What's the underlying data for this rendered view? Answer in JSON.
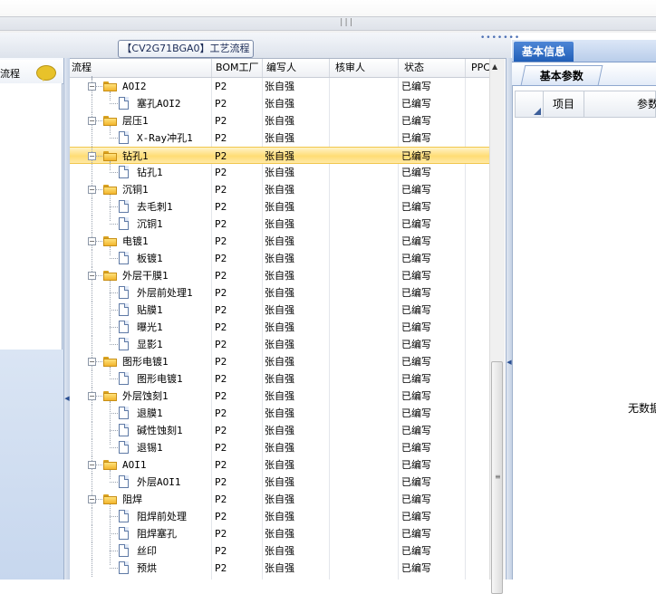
{
  "window": {
    "grip_glyph": "|||"
  },
  "left_panel": {
    "header_label": "流程"
  },
  "process_title": "【CV2G71BGA0】工艺流程",
  "grid": {
    "columns": [
      "流程",
      "BOM工厂",
      "编写人",
      "核审人",
      "状态",
      "PPC"
    ],
    "rows": [
      {
        "level": 0,
        "type": "folder",
        "name": "AOI2",
        "bom": "P2",
        "writer": "张自强",
        "reviewer": "",
        "status": "已编写",
        "ppc": ""
      },
      {
        "level": 1,
        "type": "doc",
        "name": "塞孔AOI2",
        "bom": "P2",
        "writer": "张自强",
        "reviewer": "",
        "status": "已编写",
        "ppc": ""
      },
      {
        "level": 0,
        "type": "folder",
        "name": "层压1",
        "bom": "P2",
        "writer": "张自强",
        "reviewer": "",
        "status": "已编写",
        "ppc": ""
      },
      {
        "level": 1,
        "type": "doc",
        "name": "X-Ray冲孔1",
        "bom": "P2",
        "writer": "张自强",
        "reviewer": "",
        "status": "已编写",
        "ppc": ""
      },
      {
        "level": 0,
        "type": "folder",
        "name": "钻孔1",
        "bom": "P2",
        "writer": "张自强",
        "reviewer": "",
        "status": "已编写",
        "ppc": "",
        "selected": true
      },
      {
        "level": 1,
        "type": "doc",
        "name": "钻孔1",
        "bom": "P2",
        "writer": "张自强",
        "reviewer": "",
        "status": "已编写",
        "ppc": ""
      },
      {
        "level": 0,
        "type": "folder",
        "name": "沉铜1",
        "bom": "P2",
        "writer": "张自强",
        "reviewer": "",
        "status": "已编写",
        "ppc": ""
      },
      {
        "level": 1,
        "type": "doc",
        "name": "去毛刺1",
        "bom": "P2",
        "writer": "张自强",
        "reviewer": "",
        "status": "已编写",
        "ppc": ""
      },
      {
        "level": 1,
        "type": "doc",
        "name": "沉铜1",
        "bom": "P2",
        "writer": "张自强",
        "reviewer": "",
        "status": "已编写",
        "ppc": ""
      },
      {
        "level": 0,
        "type": "folder",
        "name": "电镀1",
        "bom": "P2",
        "writer": "张自强",
        "reviewer": "",
        "status": "已编写",
        "ppc": ""
      },
      {
        "level": 1,
        "type": "doc",
        "name": "板镀1",
        "bom": "P2",
        "writer": "张自强",
        "reviewer": "",
        "status": "已编写",
        "ppc": ""
      },
      {
        "level": 0,
        "type": "folder",
        "name": "外层干膜1",
        "bom": "P2",
        "writer": "张自强",
        "reviewer": "",
        "status": "已编写",
        "ppc": ""
      },
      {
        "level": 1,
        "type": "doc",
        "name": "外层前处理1",
        "bom": "P2",
        "writer": "张自强",
        "reviewer": "",
        "status": "已编写",
        "ppc": ""
      },
      {
        "level": 1,
        "type": "doc",
        "name": "贴膜1",
        "bom": "P2",
        "writer": "张自强",
        "reviewer": "",
        "status": "已编写",
        "ppc": ""
      },
      {
        "level": 1,
        "type": "doc",
        "name": "曝光1",
        "bom": "P2",
        "writer": "张自强",
        "reviewer": "",
        "status": "已编写",
        "ppc": ""
      },
      {
        "level": 1,
        "type": "doc",
        "name": "显影1",
        "bom": "P2",
        "writer": "张自强",
        "reviewer": "",
        "status": "已编写",
        "ppc": ""
      },
      {
        "level": 0,
        "type": "folder",
        "name": "图形电镀1",
        "bom": "P2",
        "writer": "张自强",
        "reviewer": "",
        "status": "已编写",
        "ppc": ""
      },
      {
        "level": 1,
        "type": "doc",
        "name": "图形电镀1",
        "bom": "P2",
        "writer": "张自强",
        "reviewer": "",
        "status": "已编写",
        "ppc": ""
      },
      {
        "level": 0,
        "type": "folder",
        "name": "外层蚀刻1",
        "bom": "P2",
        "writer": "张自强",
        "reviewer": "",
        "status": "已编写",
        "ppc": ""
      },
      {
        "level": 1,
        "type": "doc",
        "name": "退膜1",
        "bom": "P2",
        "writer": "张自强",
        "reviewer": "",
        "status": "已编写",
        "ppc": ""
      },
      {
        "level": 1,
        "type": "doc",
        "name": "碱性蚀刻1",
        "bom": "P2",
        "writer": "张自强",
        "reviewer": "",
        "status": "已编写",
        "ppc": ""
      },
      {
        "level": 1,
        "type": "doc",
        "name": "退锡1",
        "bom": "P2",
        "writer": "张自强",
        "reviewer": "",
        "status": "已编写",
        "ppc": ""
      },
      {
        "level": 0,
        "type": "folder",
        "name": "AOI1",
        "bom": "P2",
        "writer": "张自强",
        "reviewer": "",
        "status": "已编写",
        "ppc": ""
      },
      {
        "level": 1,
        "type": "doc",
        "name": "外层AOI1",
        "bom": "P2",
        "writer": "张自强",
        "reviewer": "",
        "status": "已编写",
        "ppc": ""
      },
      {
        "level": 0,
        "type": "folder",
        "name": "阻焊",
        "bom": "P2",
        "writer": "张自强",
        "reviewer": "",
        "status": "已编写",
        "ppc": ""
      },
      {
        "level": 1,
        "type": "doc",
        "name": "阻焊前处理",
        "bom": "P2",
        "writer": "张自强",
        "reviewer": "",
        "status": "已编写",
        "ppc": ""
      },
      {
        "level": 1,
        "type": "doc",
        "name": "阻焊塞孔",
        "bom": "P2",
        "writer": "张自强",
        "reviewer": "",
        "status": "已编写",
        "ppc": ""
      },
      {
        "level": 1,
        "type": "doc",
        "name": "丝印",
        "bom": "P2",
        "writer": "张自强",
        "reviewer": "",
        "status": "已编写",
        "ppc": ""
      },
      {
        "level": 1,
        "type": "doc",
        "name": "预烘",
        "bom": "P2",
        "writer": "张自强",
        "reviewer": "",
        "status": "已编写",
        "ppc": ""
      }
    ]
  },
  "right_panel": {
    "tab_label": "基本信息",
    "subtab_label": "基本参数",
    "col_item": "项目",
    "col_param": "参数",
    "empty_text": "无数据"
  },
  "colors": {
    "accent": "#215fb8",
    "selection": "#ffdc74"
  }
}
